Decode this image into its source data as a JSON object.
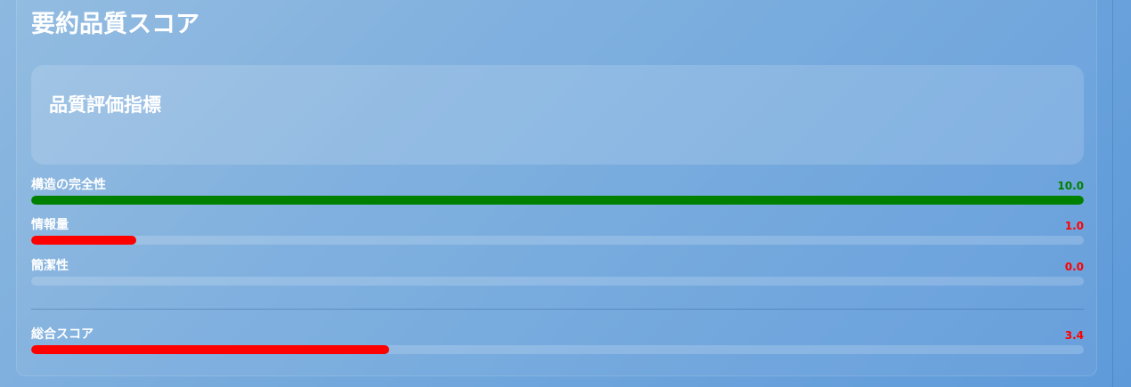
{
  "page": {
    "title": "要約品質スコア"
  },
  "card": {
    "title": "品質評価指標"
  },
  "metrics": [
    {
      "label": "構造の完全性",
      "value": "10.0",
      "score": 10.0,
      "max": 10,
      "color": "#008000"
    },
    {
      "label": "情報量",
      "value": "1.0",
      "score": 1.0,
      "max": 10,
      "color": "#ff0000"
    },
    {
      "label": "簡潔性",
      "value": "0.0",
      "score": 0.0,
      "max": 10,
      "color": "#ff0000"
    }
  ],
  "overall": {
    "label": "総合スコア",
    "value": "3.4",
    "score": 3.4,
    "max": 10,
    "color": "#ff0000"
  }
}
